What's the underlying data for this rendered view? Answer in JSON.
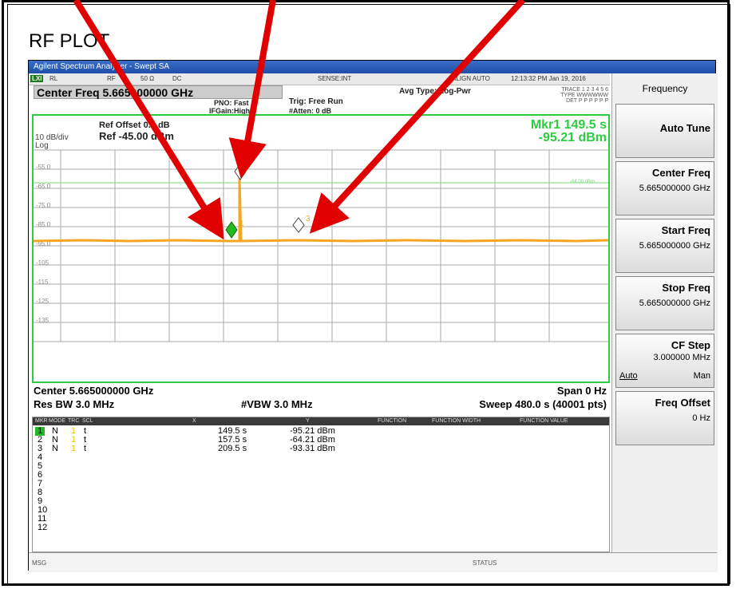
{
  "page_title": "RF PLOT",
  "window_title": "Agilent Spectrum Analyzer - Swept SA",
  "status": {
    "lxi": "LXI",
    "rl": "RL",
    "rf": "RF",
    "impedance": "50 Ω",
    "coupling": "DC",
    "sense": "SENSE:INT",
    "align": "ALIGN AUTO",
    "datetime": "12:13:32 PM Jan 19, 2016"
  },
  "center_freq_header": "Center Freq 5.665000000 GHz",
  "pno": "PNO: Fast",
  "ifgain": "IFGain:High",
  "trig": "Trig: Free Run",
  "atten": "#Atten: 0 dB",
  "avg_type": "Avg Type: Log-Pwr",
  "trace_line": "TRACE 1 2 3 4 5 6",
  "type_line": "TYPE WWWWWW",
  "det_line": "DET P P P P P P",
  "plot": {
    "ref_offset": "Ref Offset 0.5 dB",
    "ref_level": "Ref -45.00 dBm",
    "scale": "10 dB/div",
    "log": "Log",
    "y_ticks": [
      "-55.0",
      "-65.0",
      "-75.0",
      "-85.0",
      "-95.0",
      "-105",
      "-115",
      "-125",
      "-135"
    ],
    "threshold_label": "-64.00 dBm",
    "mkr_title": "Mkr1 149.5 s",
    "mkr_value": "-95.21 dBm",
    "marker_labels": [
      "1",
      "2",
      "3"
    ]
  },
  "bottom": {
    "center": "Center 5.665000000 GHz",
    "span": "Span 0 Hz",
    "res_bw": "Res BW 3.0 MHz",
    "vbw": "#VBW 3.0 MHz",
    "sweep": "Sweep 480.0 s (40001 pts)"
  },
  "table": {
    "headers": [
      "MKR",
      "MODE",
      "TRC",
      "SCL",
      "X",
      "Y",
      "FUNCTION",
      "FUNCTION WIDTH",
      "FUNCTION VALUE"
    ],
    "rows": [
      {
        "n": "1",
        "mode": "N",
        "trc": "1",
        "scl": "t",
        "x": "149.5 s",
        "y": "-95.21 dBm"
      },
      {
        "n": "2",
        "mode": "N",
        "trc": "1",
        "scl": "t",
        "x": "157.5 s",
        "y": "-64.21 dBm"
      },
      {
        "n": "3",
        "mode": "N",
        "trc": "1",
        "scl": "t",
        "x": "209.5 s",
        "y": "-93.31 dBm"
      },
      {
        "n": "4"
      },
      {
        "n": "5"
      },
      {
        "n": "6"
      },
      {
        "n": "7"
      },
      {
        "n": "8"
      },
      {
        "n": "9"
      },
      {
        "n": "10"
      },
      {
        "n": "11"
      },
      {
        "n": "12"
      }
    ]
  },
  "softkeys": {
    "title": "Frequency",
    "auto_tune": "Auto Tune",
    "center_freq": "Center Freq",
    "center_freq_val": "5.665000000 GHz",
    "start_freq": "Start Freq",
    "start_freq_val": "5.665000000 GHz",
    "stop_freq": "Stop Freq",
    "stop_freq_val": "5.665000000 GHz",
    "cf_step": "CF Step",
    "cf_step_val": "3.000000 MHz",
    "cf_auto": "Auto",
    "cf_man": "Man",
    "freq_offset": "Freq Offset",
    "freq_offset_val": "0 Hz"
  },
  "msg": "MSG",
  "status_label": "STATUS",
  "colors": {
    "accent_green": "#2ecc40",
    "trace_orange": "#f5a623",
    "arrow_red": "#e00000"
  }
}
